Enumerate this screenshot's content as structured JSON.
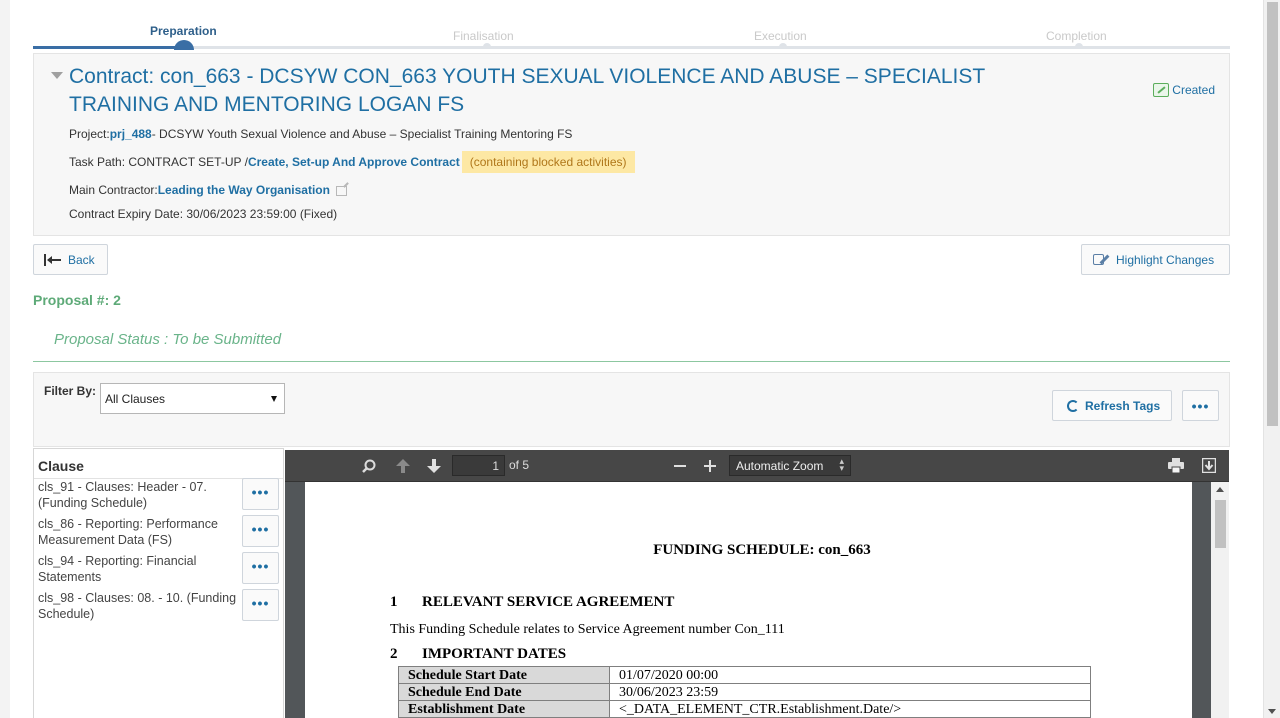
{
  "stepper": {
    "steps": [
      "Preparation",
      "Finalisation",
      "Execution",
      "Completion"
    ]
  },
  "contract": {
    "title": "Contract: con_663 - DCSYW CON_663 YOUTH SEXUAL VIOLENCE AND ABUSE – SPECIALIST TRAINING AND MENTORING LOGAN FS",
    "status": "Created",
    "project_label": "Project:",
    "project_code": "prj_488",
    "project_desc": "- DCSYW Youth Sexual Violence and Abuse – Specialist Training Mentoring FS",
    "task_path_label": "Task Path: CONTRACT SET-UP /",
    "task_path_link": "Create, Set-up And Approve Contract",
    "blocked_note": "(containing blocked activities)",
    "main_contractor_label": "Main Contractor:",
    "main_contractor": "Leading the Way Organisation",
    "expiry": "Contract Expiry Date: 30/06/2023 23:59:00 (Fixed)"
  },
  "actions": {
    "back": "Back",
    "highlight": "Highlight Changes",
    "refresh": "Refresh Tags",
    "more": "•••"
  },
  "proposal": {
    "number": "Proposal #: 2",
    "status": "Proposal Status : To be Submitted"
  },
  "filter": {
    "label": "Filter By:",
    "selected": "All Clauses"
  },
  "clauses": {
    "header": "Clause",
    "items": [
      "cls_91 - Clauses: Header - 07. (Funding Schedule)",
      "cls_86 - Reporting: Performance Measurement Data (FS)",
      "cls_94 - Reporting: Financial Statements",
      "cls_98 - Clauses: 08. - 10. (Funding Schedule)"
    ],
    "menu_label": "•••"
  },
  "pdf": {
    "page_current": "1",
    "page_total": "of 5",
    "zoom": "Automatic Zoom",
    "doc_title": "FUNDING SCHEDULE: con_663",
    "section1_num": "1",
    "section1_title": "RELEVANT SERVICE AGREEMENT",
    "section1_text": "This Funding Schedule relates to Service Agreement number Con_111",
    "section2_num": "2",
    "section2_title": "IMPORTANT DATES",
    "dates": [
      {
        "k": "Schedule Start Date",
        "v": "01/07/2020 00:00"
      },
      {
        "k": "Schedule End Date",
        "v": "30/06/2023 23:59"
      },
      {
        "k": "Establishment Date",
        "v": "<_DATA_ELEMENT_CTR.Establishment.Date/>"
      }
    ]
  },
  "icons": [
    "caret-down-icon",
    "created-status-icon",
    "external-link-icon",
    "back-arrow-icon",
    "highlight-changes-icon",
    "refresh-icon",
    "search-icon",
    "previous-page-icon",
    "next-page-icon",
    "zoom-out-icon",
    "zoom-in-icon",
    "print-icon",
    "download-icon"
  ]
}
